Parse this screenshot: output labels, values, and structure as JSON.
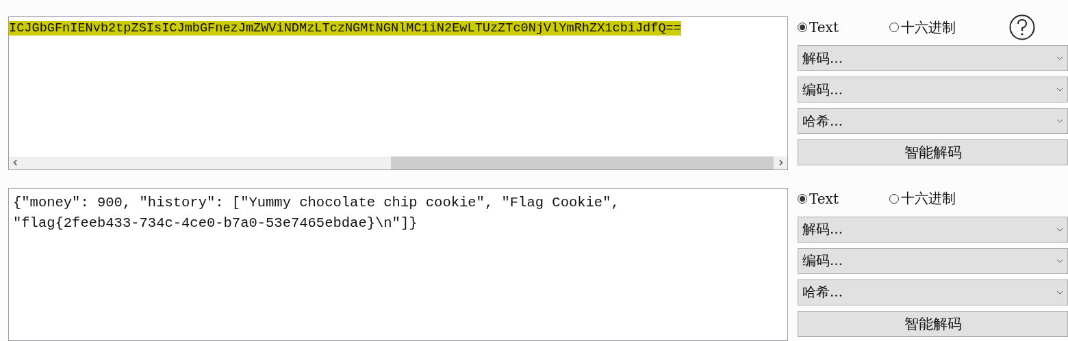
{
  "panels": [
    {
      "text": "ICJGbGFnIENvb2tpZSIsICJmbGFnezJmZWViNDMzLTczNGMtNGNlMC1iN2EwLTUzZTc0NjVlYmRhZX1cbiJdfQ==",
      "highlighted": true,
      "horizontal_scrollbar": true,
      "help": true,
      "modes": [
        {
          "label": "Text",
          "selected": true
        },
        {
          "label": "十六进制",
          "selected": false
        }
      ],
      "dropdowns": [
        "解码...",
        "编码...",
        "哈希..."
      ],
      "button": "智能解码"
    },
    {
      "text": "{\"money\": 900, \"history\": [\"Yummy chocolate chip cookie\", \"Flag Cookie\", \"flag{2feeb433-734c-4ce0-b7a0-53e7465ebdae}\\n\"]}",
      "highlighted": false,
      "horizontal_scrollbar": false,
      "help": false,
      "modes": [
        {
          "label": "Text",
          "selected": true
        },
        {
          "label": "十六进制",
          "selected": false
        }
      ],
      "dropdowns": [
        "解码...",
        "编码...",
        "哈希..."
      ],
      "button": "智能解码"
    }
  ]
}
